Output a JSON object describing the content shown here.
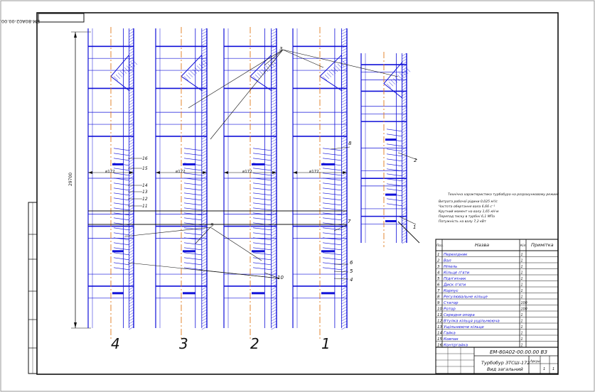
{
  "sheet": {
    "stamp_top": "ЕМ-80А02-00.00.00 ВЗ",
    "drawing_number": "ЕМ-80А02-00.00.00 ВЗ",
    "title_line1": "Турбобур ЗТСШ-172",
    "title_line2": "Вид загальний",
    "sheet_label": "Аркуш",
    "sheet_count": "1",
    "sheet_number": "1"
  },
  "views": [
    {
      "number": "4"
    },
    {
      "number": "3"
    },
    {
      "number": "2"
    },
    {
      "number": "1"
    }
  ],
  "dimensions": {
    "length_label": "29700",
    "diameter_label": "⌀172"
  },
  "callouts": [
    "1",
    "2",
    "3",
    "4",
    "5",
    "6",
    "7",
    "8",
    "9",
    "10",
    "11",
    "12",
    "13",
    "14",
    "15",
    "16"
  ],
  "spec_notes": {
    "heading": "Технічна характеристика турбобура на розрахунковому режимі",
    "lines": [
      "Витрата робочої рідини          0,025 м³/с",
      "Частота обертання вала          6,66 с⁻¹",
      "Крутний момент на валу          1,65 кН·м",
      "Перепад тиску в турбіні         6,1 МПа",
      "Потужність на валу              7,2 кВт"
    ]
  },
  "parts_table": {
    "headers": {
      "pos": "Поз.",
      "name": "Назва",
      "qty": "Кіл.",
      "note": "Примітка"
    },
    "rows": [
      {
        "pos": "1",
        "name": "Перехідник",
        "qty": "1"
      },
      {
        "pos": "2",
        "name": "Вал",
        "qty": "1"
      },
      {
        "pos": "3",
        "name": "Ніпель",
        "qty": "1"
      },
      {
        "pos": "4",
        "name": "Кільце п'яти",
        "qty": "1"
      },
      {
        "pos": "5",
        "name": "Підп'ятник",
        "qty": "1"
      },
      {
        "pos": "6",
        "name": "Диск п'яти",
        "qty": "1"
      },
      {
        "pos": "7",
        "name": "Корпус",
        "qty": "1"
      },
      {
        "pos": "8",
        "name": "Регулювальне кільце",
        "qty": "1"
      },
      {
        "pos": "9",
        "name": "Статор",
        "qty": "100"
      },
      {
        "pos": "10",
        "name": "Ротор",
        "qty": "100"
      },
      {
        "pos": "11",
        "name": "Середня опора",
        "qty": "1"
      },
      {
        "pos": "12",
        "name": "Втулка кільця ущільнююча",
        "qty": "1"
      },
      {
        "pos": "13",
        "name": "Ущільнююче кільце",
        "qty": "1"
      },
      {
        "pos": "14",
        "name": "Гайка",
        "qty": "1"
      },
      {
        "pos": "15",
        "name": "Ковпак",
        "qty": "1"
      },
      {
        "pos": "16",
        "name": "Контргайка",
        "qty": "1"
      }
    ]
  },
  "colors": {
    "line": "#1010d8",
    "axis": "#e07a1a",
    "frame": "#111111"
  }
}
